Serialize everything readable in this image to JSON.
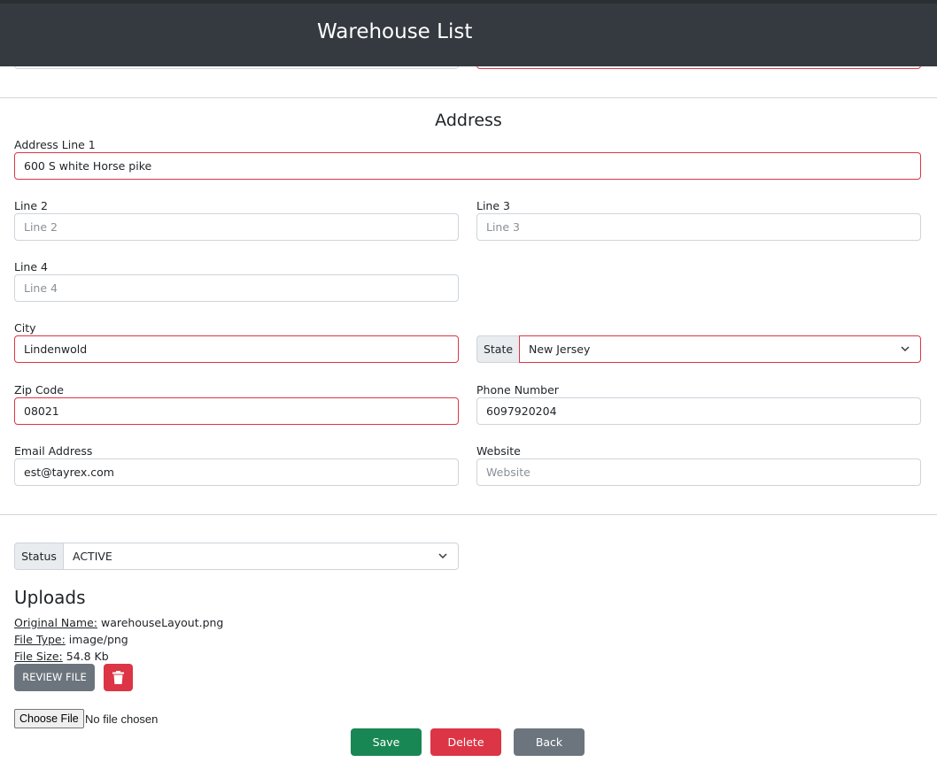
{
  "header": {
    "title": "Warehouse List"
  },
  "address": {
    "section_title": "Address",
    "line1": {
      "label": "Address Line 1",
      "value": "600 S white Horse pike"
    },
    "line2": {
      "label": "Line 2",
      "placeholder": "Line 2"
    },
    "line3": {
      "label": "Line 3",
      "placeholder": "Line 3"
    },
    "line4": {
      "label": "Line 4",
      "placeholder": "Line 4"
    },
    "city": {
      "label": "City",
      "value": "Lindenwold"
    },
    "state": {
      "label": "State",
      "value": "New Jersey"
    },
    "zip": {
      "label": "Zip Code",
      "value": "08021"
    },
    "phone": {
      "label": "Phone Number",
      "value": "6097920204"
    },
    "email": {
      "label": "Email Address",
      "value": "est@tayrex.com"
    },
    "website": {
      "label": "Website",
      "placeholder": "Website"
    }
  },
  "status": {
    "label": "Status",
    "value": "ACTIVE"
  },
  "uploads": {
    "title": "Uploads",
    "original_name_label": "Original Name:",
    "original_name": "warehouseLayout.png",
    "file_type_label": "File Type:",
    "file_type": "image/png",
    "file_size_label": "File Size:",
    "file_size": "54.8 Kb",
    "review_label": "REVIEW FILE",
    "choose_label": "Choose File",
    "no_file_text": "No file chosen"
  },
  "actions": {
    "save": "Save",
    "delete": "Delete",
    "back": "Back"
  },
  "colors": {
    "invalid": "#dc3545",
    "success": "#198754",
    "secondary": "#6c757d",
    "navbar": "#343a40"
  },
  "icons": {
    "select_arrow": "chevron-down-icon",
    "delete_file": "trash-icon"
  }
}
